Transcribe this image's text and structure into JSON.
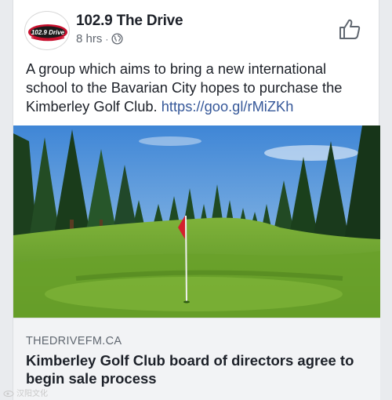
{
  "post": {
    "page_name": "102.9 The Drive",
    "time": "8 hrs",
    "separator": "·",
    "text": "A group which aims to bring a new international school to the Bavarian City hopes to purchase the Kimberley Golf Club.",
    "link_text": "https://goo.gl/rMiZKh",
    "avatar_logo_text": "102.9 Drive",
    "icons": {
      "audience": "globe-icon",
      "like": "thumbs-up-icon"
    }
  },
  "link_preview": {
    "domain": "THEDRIVEFM.CA",
    "title": "Kimberley Golf Club board of directors agree to begin sale process"
  },
  "watermark": {
    "text": "汉阳文化"
  },
  "colors": {
    "link": "#365899",
    "logo_red": "#c8102e",
    "grass": "#6fa32d",
    "sky": "#6fa8e0"
  }
}
